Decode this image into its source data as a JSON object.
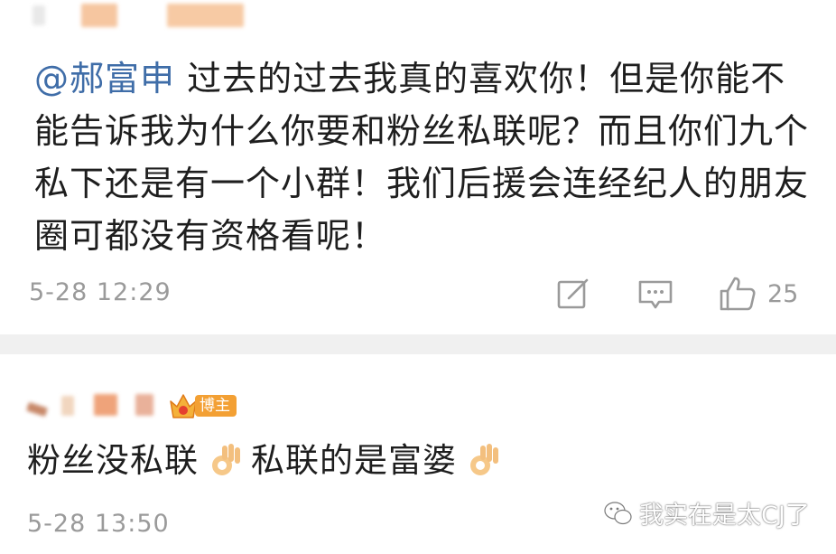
{
  "comment": {
    "mention": "@郝富申",
    "text": " 过去的过去我真的喜欢你！但是你能不能告诉我为什么你要和粉丝私联呢？而且你们九个私下还是有一个小群！我们后援会连经纪人的朋友圈可都没有资格看呢！",
    "time": "5-28 12:29",
    "like_count": "25",
    "icons": {
      "share": "share-edit-icon",
      "comment": "comment-icon",
      "like": "thumbs-up-icon"
    }
  },
  "reply": {
    "badge_label": "博主",
    "text_part1": "粉丝没私联",
    "text_part2": "私联的是富婆",
    "time": "5-28 13:50",
    "icons": {
      "badge": "crown-badge-icon",
      "emoji": "ok-hand-emoji"
    }
  },
  "watermark": {
    "text": "我实在是太CJ了",
    "icon": "wechat-icon"
  },
  "colors": {
    "mention": "#3f6da8",
    "meta": "#9a9a9a",
    "badge": "#f3a034",
    "divider": "#f0f0f0"
  }
}
